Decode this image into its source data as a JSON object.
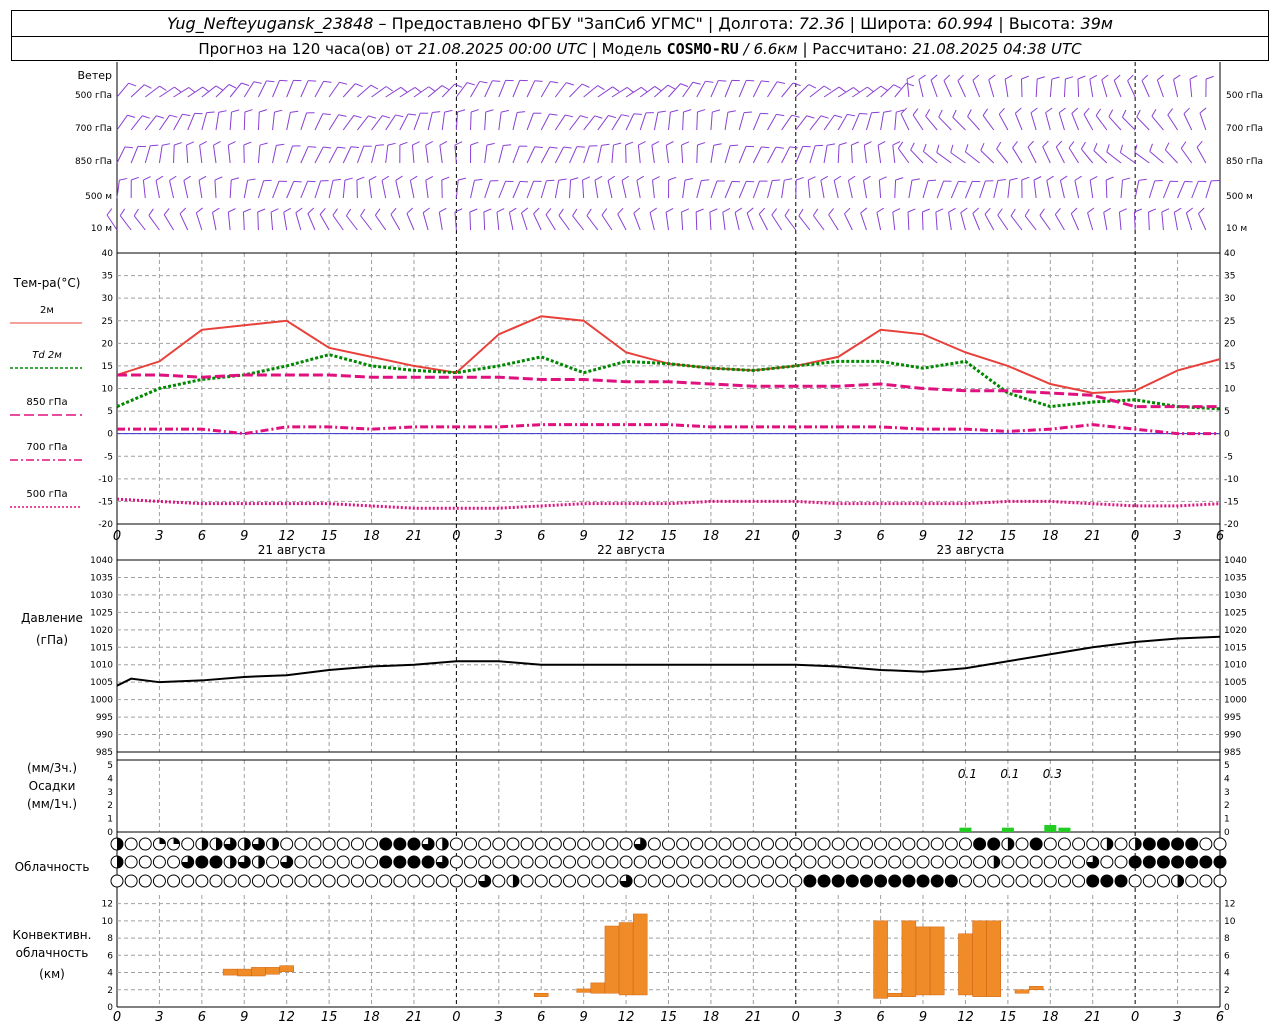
{
  "header": {
    "station": "Yug_Nefteyugansk_23848",
    "provider": "– Предоставлено ФГБУ \"ЗапСиб УГМС\"",
    "lon_label": "Долгота:",
    "lon": "72.36",
    "lat_label": "Широта:",
    "lat": "60.994",
    "alt_label": "Высота:",
    "alt": "39м",
    "forecast_label": "Прогноз на 120 часа(ов) от",
    "run_time": "21.08.2025 00:00 UTC",
    "model_label": "Модель",
    "model": "COSMO-RU",
    "res": "/ 6.6км",
    "calc_label": "Рассчитано:",
    "calc_time": "21.08.2025 04:38 UTC"
  },
  "colors": {
    "t2m": "#e8403a",
    "td": "#008800",
    "t850": "#e0107f",
    "t700": "#e0107f",
    "t500": "#e0107f",
    "wind": "#8a3fd4",
    "pressure": "#000000",
    "precip": "#22cc22",
    "convective": "#f08c28",
    "grid": "#a0a0a0"
  },
  "x_axis": {
    "ticks": [
      "0",
      "3",
      "6",
      "9",
      "12",
      "15",
      "18",
      "21",
      "0",
      "3",
      "6",
      "9",
      "12",
      "15",
      "18",
      "21",
      "0",
      "3",
      "6",
      "9",
      "12",
      "15",
      "18",
      "21",
      "0",
      "3",
      "6"
    ],
    "day_labels": [
      "21 августа",
      "22 августа",
      "23 августа"
    ]
  },
  "wind_panel": {
    "title": "Ветер",
    "levels": [
      "500 гПа",
      "700 гПа",
      "850 гПа",
      "500  м",
      "10   м"
    ]
  },
  "temp_panel": {
    "title": "Тем-ра(°C)",
    "legend": [
      "2м",
      "Td  2м",
      "850 гПа",
      "700 гПа",
      "500 гПа"
    ],
    "yticks": [
      "40",
      "35",
      "30",
      "25",
      "20",
      "15",
      "10",
      "5",
      "0",
      "-5",
      "-10",
      "-15",
      "-20"
    ]
  },
  "pressure_panel": {
    "title": "Давление",
    "unit": "(гПа)",
    "yticks": [
      "1040",
      "1035",
      "1030",
      "1025",
      "1020",
      "1015",
      "1010",
      "1005",
      "1000",
      "995",
      "990",
      "985"
    ]
  },
  "precip_panel": {
    "unit3": "(мм/3ч.)",
    "title": "Осадки",
    "unit1": "(мм/1ч.)",
    "yticks": [
      "5",
      "4",
      "3",
      "2",
      "1",
      "0"
    ],
    "labels": [
      "0.1",
      "0.1",
      "0.3"
    ]
  },
  "cloud_panel": {
    "title": "Облачность"
  },
  "conv_panel": {
    "title1": "Конвективн.",
    "title2": "облачность",
    "unit": "(км)",
    "yticks": [
      "12",
      "10",
      "8",
      "6",
      "4",
      "2",
      "0"
    ]
  },
  "chart_data": [
    {
      "type": "line",
      "title": "Тем-ра(°C)",
      "x_hours": [
        0,
        3,
        6,
        9,
        12,
        15,
        18,
        21,
        24,
        27,
        30,
        33,
        36,
        39,
        42,
        45,
        48,
        51,
        54,
        57,
        60,
        63,
        66,
        69,
        72,
        75,
        78
      ],
      "ylim": [
        -20,
        40
      ],
      "series": [
        {
          "name": "2м",
          "values": [
            13,
            16,
            23,
            24,
            25,
            19,
            17,
            15,
            13.5,
            22,
            26,
            25,
            18,
            15.5,
            14.5,
            14,
            15,
            17,
            23,
            22,
            18,
            15,
            11,
            9,
            9.5,
            14,
            16.5
          ]
        },
        {
          "name": "Td  2м",
          "values": [
            6,
            10,
            12,
            13,
            15,
            17.5,
            15,
            14,
            13.5,
            15,
            17,
            13.5,
            16,
            15.5,
            14.5,
            14,
            15,
            16,
            16,
            14.5,
            16,
            9,
            6,
            7,
            7.5,
            6,
            5.5
          ]
        },
        {
          "name": "850 гПа",
          "values": [
            13,
            13,
            12.5,
            13,
            13,
            13,
            12.5,
            12.5,
            12.5,
            12.5,
            12,
            12,
            11.5,
            11.5,
            11,
            10.5,
            10.5,
            10.5,
            11,
            10,
            9.5,
            9.5,
            9,
            8.5,
            6,
            6,
            6
          ]
        },
        {
          "name": "700 гПа",
          "values": [
            1,
            1,
            1,
            0,
            1.5,
            1.5,
            1,
            1.5,
            1.5,
            1.5,
            2,
            2,
            2,
            2,
            1.5,
            1.5,
            1.5,
            1.5,
            1.5,
            1,
            1,
            0.5,
            1,
            2,
            1,
            0,
            0
          ]
        },
        {
          "name": "500 гПа",
          "values": [
            -14.5,
            -15,
            -15.5,
            -15.5,
            -15.5,
            -15.5,
            -16,
            -16.5,
            -16.5,
            -16.5,
            -16,
            -15.5,
            -15.5,
            -15.5,
            -15,
            -15,
            -15,
            -15.5,
            -15.5,
            -15.5,
            -15.5,
            -15,
            -15,
            -15.5,
            -16,
            -16,
            -15.5
          ]
        }
      ]
    },
    {
      "type": "line",
      "title": "Давление",
      "x_hours": [
        0,
        1,
        3,
        6,
        9,
        12,
        15,
        18,
        21,
        24,
        27,
        30,
        33,
        36,
        39,
        42,
        45,
        48,
        51,
        54,
        57,
        60,
        63,
        66,
        69,
        72,
        75,
        78
      ],
      "ylim": [
        985,
        1040
      ],
      "series": [
        {
          "name": "",
          "values": [
            1004,
            1006,
            1005,
            1005.5,
            1006.5,
            1007,
            1008.5,
            1009.5,
            1010,
            1011,
            1011,
            1010,
            1010,
            1010,
            1010,
            1010,
            1010,
            1010,
            1009.5,
            1008.5,
            1008,
            1009,
            1011,
            1013,
            1015,
            1016.5,
            1017.5,
            1018
          ]
        }
      ]
    },
    {
      "type": "bar",
      "title": "Осадки",
      "ylim": [
        0,
        5
      ],
      "x_hours": [
        60,
        63,
        66,
        67
      ],
      "values": [
        0.1,
        0.1,
        0.3,
        0.1
      ],
      "labels": [
        "0.1",
        "0.1",
        "0.3"
      ]
    },
    {
      "type": "bar",
      "title": "Конвективн. облачность",
      "ylim": [
        0,
        12
      ],
      "bars": [
        {
          "h": 8,
          "base": 3.7,
          "top": 4.4
        },
        {
          "h": 9,
          "base": 3.6,
          "top": 4.4
        },
        {
          "h": 10,
          "base": 3.6,
          "top": 4.6
        },
        {
          "h": 11,
          "base": 3.8,
          "top": 4.6
        },
        {
          "h": 12,
          "base": 4.1,
          "top": 4.8
        },
        {
          "h": 30,
          "base": 1.2,
          "top": 1.6
        },
        {
          "h": 33,
          "base": 1.7,
          "top": 2.1
        },
        {
          "h": 34,
          "base": 1.6,
          "top": 2.8
        },
        {
          "h": 35,
          "base": 1.6,
          "top": 9.4
        },
        {
          "h": 36,
          "base": 1.4,
          "top": 9.8
        },
        {
          "h": 37,
          "base": 1.4,
          "top": 10.8
        },
        {
          "h": 54,
          "base": 1,
          "top": 10
        },
        {
          "h": 55,
          "base": 1.2,
          "top": 1.6
        },
        {
          "h": 56,
          "base": 1.2,
          "top": 10
        },
        {
          "h": 57,
          "base": 1.4,
          "top": 9.3
        },
        {
          "h": 58,
          "base": 1.4,
          "top": 9.3
        },
        {
          "h": 60,
          "base": 1.4,
          "top": 8.5
        },
        {
          "h": 61,
          "base": 1.2,
          "top": 10
        },
        {
          "h": 62,
          "base": 1.2,
          "top": 10
        },
        {
          "h": 64,
          "base": 1.6,
          "top": 2
        },
        {
          "h": 65,
          "base": 2,
          "top": 2.4
        }
      ]
    }
  ]
}
